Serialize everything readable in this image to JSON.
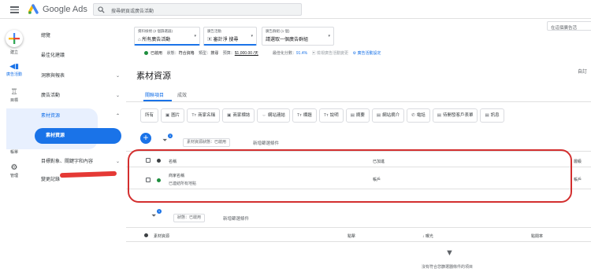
{
  "topbar": {
    "brand": "Google Ads",
    "search_placeholder": "搜尋網頁或廣告活動",
    "right_search": "在這個廣告活"
  },
  "rail": {
    "create": "建立",
    "campaigns": "廣告活動",
    "goals": "目標",
    "tools": "工具",
    "billing": "帳單",
    "admin": "管理"
  },
  "nav": {
    "overview": "總覽",
    "recommendations": "最佳化建議",
    "insights": "洞察與報表",
    "campaigns": "廣告活動",
    "assets": "素材資源",
    "assets_sub": "素材資源",
    "audiences": "目標對象、關鍵字和內容",
    "change_history": "變更記錄"
  },
  "breadcrumbs": [
    {
      "key": "資料檢視 (2 個篩選器)",
      "value": "所有廣告活動"
    },
    {
      "key": "廣告活動",
      "value": "審計淨 搜尋"
    },
    {
      "key": "廣告群組 (1 個)",
      "value": "請選取一個廣告群組"
    }
  ],
  "status": {
    "enabled": "已啟用",
    "status_label": "狀態：",
    "status_value": "符合資格",
    "type_label": "類型：",
    "type_value": "搜尋",
    "budget_label": "預算：",
    "budget_value": "$1,000.00 /天",
    "opt_label": "最佳化分數：",
    "opt_value": "91.4%",
    "view_changes": "檢視廣告活動變更",
    "settings": "廣告活動設定"
  },
  "page": {
    "title": "素材資源",
    "view_label": "自訂"
  },
  "tabs": [
    "關聯項目",
    "成效"
  ],
  "chips": [
    {
      "icon": "",
      "label": "所有"
    },
    {
      "icon": "▣",
      "label": "圖片"
    },
    {
      "icon": "Tт",
      "label": "商家名稱"
    },
    {
      "icon": "▣",
      "label": "商家標誌"
    },
    {
      "icon": "⇔",
      "label": "網站連結"
    },
    {
      "icon": "Tт",
      "label": "標題"
    },
    {
      "icon": "Tт",
      "label": "說明"
    },
    {
      "icon": "▤",
      "label": "摘要"
    },
    {
      "icon": "▤",
      "label": "網站摘介"
    },
    {
      "icon": "✆",
      "label": "電話"
    },
    {
      "icon": "▤",
      "label": "待開發客戶表單"
    },
    {
      "icon": "▤",
      "label": "訊息"
    }
  ],
  "filters_top": {
    "chip": "素材資源狀態：已啟用",
    "add": "新增篩選條件",
    "badge": "1"
  },
  "table1": {
    "headers": {
      "name": "名稱",
      "added_to": "已加進",
      "level": "層級"
    },
    "row": {
      "name_prefix": "商家名稱",
      "sub": "已連結所有地點",
      "added_to": "帳戶",
      "level": "帳戶"
    }
  },
  "filters_bottom": {
    "chip": "狀態：已啟用",
    "add": "新增篩選條件",
    "badge": "1"
  },
  "table2": {
    "headers": {
      "asset": "素材資源",
      "clicks": "點擊",
      "impr": "↓ 曝光",
      "ctr": "點閱率"
    },
    "empty": "沒有符合您篩選器條件的項目"
  },
  "colors": {
    "accent": "#1a73e8",
    "enabled": "#1e8e3e",
    "annotation": "#d32f2f"
  }
}
